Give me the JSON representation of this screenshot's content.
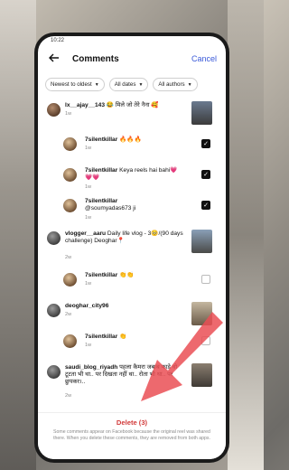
{
  "status": {
    "time": "10:22"
  },
  "header": {
    "title": "Comments",
    "cancel_label": "Cancel"
  },
  "filters": [
    {
      "label": "Newest to oldest"
    },
    {
      "label": "All dates"
    },
    {
      "label": "All authors"
    }
  ],
  "comments": [
    {
      "username": "lx__ajay__143",
      "text": "😂 मिले जो तेरे नैना 🥰",
      "time": "1w",
      "checked": null
    },
    {
      "username": "7silentkillar",
      "text": "🔥🔥🔥",
      "time": "1w",
      "checked": true
    },
    {
      "username": "7silentkillar",
      "text": "Keya reels hai bahi💗💗💗",
      "time": "1w",
      "checked": true
    },
    {
      "username": "7silentkillar",
      "text": "@soumyadas673 ji",
      "time": "1w",
      "checked": true
    },
    {
      "username": "vlogger__aaru",
      "text": "Daily life vlog - 3🥺/(90 days challenge) Deoghar📍",
      "time": "2w",
      "checked": null
    },
    {
      "username": "7silentkillar",
      "text": "👏👏",
      "time": "1w",
      "checked": false
    },
    {
      "username": "deoghar_city96",
      "text": "",
      "time": "2w",
      "checked": null
    },
    {
      "username": "7silentkillar",
      "text": "👏",
      "time": "1w",
      "checked": false
    },
    {
      "username": "saudi_blog_riyadh",
      "text": "पहला कैमरा जबाब फाड़े वो टूटता भी था.. पर दिखता नहीं था.. रोता भी था.. पर छुपकर।..",
      "time": "2w",
      "checked": null
    }
  ],
  "footer": {
    "delete_label": "Delete (3)",
    "note": "Some comments appear on Facebook because the original reel was shared there. When you delete these comments, they are removed from both apps."
  }
}
